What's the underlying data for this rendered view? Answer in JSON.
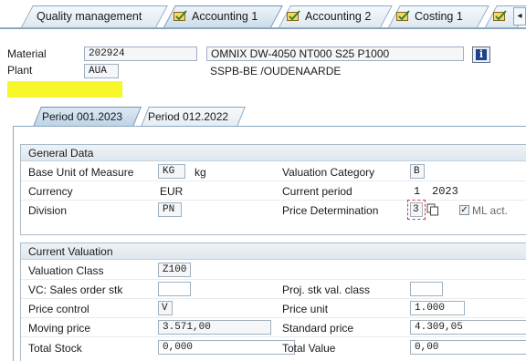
{
  "top_tabs": [
    {
      "label": "Quality management",
      "icon": ""
    },
    {
      "label": "Accounting 1",
      "icon": "accounting-icon"
    },
    {
      "label": "Accounting 2",
      "icon": "accounting-icon"
    },
    {
      "label": "Costing 1",
      "icon": "accounting-icon"
    },
    {
      "label": "",
      "icon": "accounting-icon"
    }
  ],
  "active_tab": "Accounting 1",
  "scroll_left_glyph": "◂",
  "header": {
    "material_label": "Material",
    "material_value": "202924",
    "material_description": "OMNIX DW-4050 NT000 S25 P1000",
    "plant_label": "Plant",
    "plant_value": "AUA",
    "plant_description": "SSPB-BE /OUDENAARDE",
    "info_glyph": "i"
  },
  "period_tabs": [
    {
      "label": "Period 001.2023"
    },
    {
      "label": "Period 012.2022"
    }
  ],
  "general_data": {
    "title": "General Data",
    "base_uom_label": "Base Unit of Measure",
    "base_uom_value": "KG",
    "base_uom_text": "kg",
    "currency_label": "Currency",
    "currency_value": "EUR",
    "division_label": "Division",
    "division_value": "PN",
    "valuation_category_label": "Valuation Category",
    "valuation_category_value": "B",
    "current_period_label": "Current period",
    "current_period_value": "1",
    "current_period_year": "2023",
    "price_determination_label": "Price Determination",
    "price_determination_value": "3",
    "ml_act_label": "ML act.",
    "ml_act_checked": "✓"
  },
  "current_valuation": {
    "title": "Current Valuation",
    "valuation_class_label": "Valuation Class",
    "valuation_class_value": "Z100",
    "vc_sales_order_label": "VC: Sales order stk",
    "vc_sales_order_value": "",
    "proj_stk_label": "Proj. stk val. class",
    "proj_stk_value": "",
    "price_control_label": "Price control",
    "price_control_value": "V",
    "price_unit_label": "Price unit",
    "price_unit_value": "1.000",
    "moving_price_label": "Moving price",
    "moving_price_value": "3.571,00",
    "standard_price_label": "Standard price",
    "standard_price_value": "4.309,05",
    "total_stock_label": "Total Stock",
    "total_stock_value": "0,000",
    "total_value_label": "Total Value",
    "total_value_value": "0,00"
  },
  "colors": {
    "highlight": "#f7f72a",
    "tab_border": "#8aa8c2",
    "info_button": "#1f3f8f"
  }
}
